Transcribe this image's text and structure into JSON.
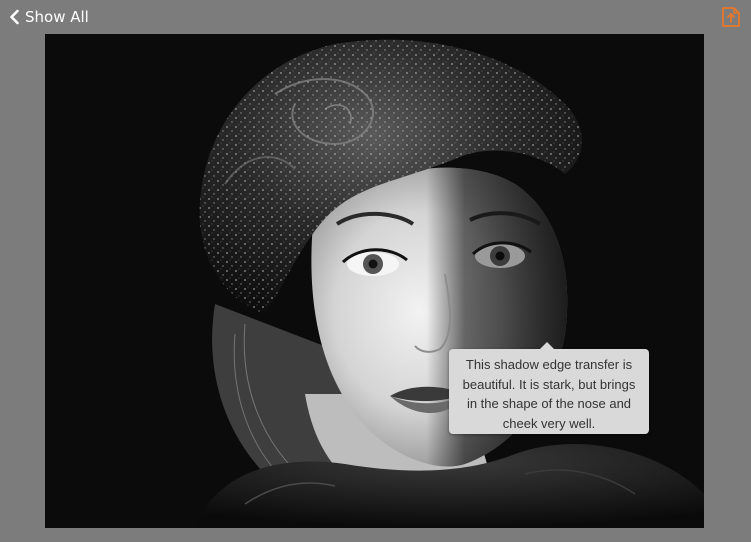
{
  "nav": {
    "back_label": "Show All",
    "back_icon": "chevron-left-icon",
    "share_icon": "share-export-icon",
    "accent_color": "#e8782a"
  },
  "photo": {
    "subject": "black-and-white portrait",
    "comment": {
      "text": "This shadow edge transfer is beautiful. It is stark, but brings in the shape of the nose and cheek very well."
    }
  }
}
